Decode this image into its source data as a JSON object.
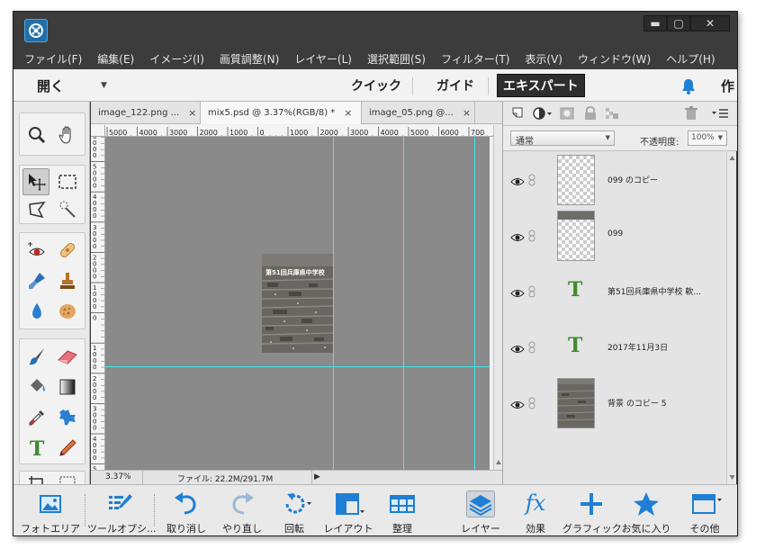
{
  "menubar": {
    "items": [
      "ファイル(F)",
      "編集(E)",
      "イメージ(I)",
      "画質調整(N)",
      "レイヤー(L)",
      "選択範囲(S)",
      "フィルター(T)",
      "表示(V)",
      "ウィンドウ(W)",
      "ヘルプ(H)"
    ]
  },
  "modebar": {
    "open_label": "開く",
    "quick": "クイック",
    "guide": "ガイド",
    "expert": "エキスパート",
    "create": "作"
  },
  "window_buttons": {
    "minimize": "▬",
    "maximize": "▢",
    "close": "✕"
  },
  "tabs": [
    {
      "label": "image_122.png ...",
      "close": "×"
    },
    {
      "label": "mix5.psd @ 3.37%(RGB/8) *",
      "close": "×"
    },
    {
      "label": "image_05.png @...",
      "close": "×"
    }
  ],
  "ruler": {
    "h_ticks": [
      "5000",
      "4000",
      "3000",
      "2000",
      "1000",
      "0",
      "1000",
      "2000",
      "3000",
      "4000",
      "5000",
      "6000",
      "700"
    ],
    "v_ticks": [
      "6\n0\n0\n0",
      "5\n0\n0\n0",
      "4\n0\n0\n0",
      "3\n0\n0\n0",
      "2\n0\n0\n0",
      "1\n0\n0\n0",
      "0",
      "1\n0\n0\n0",
      "2\n0\n0\n0",
      "3\n0\n0\n0",
      "4\n0\n0\n0",
      "5\n0\n0\n0"
    ]
  },
  "canvas": {
    "photo_title": "第51回兵庫県中学校"
  },
  "status": {
    "zoom": "3.37%",
    "file_info": "ファイル: 22.2M/291.7M",
    "arrow": "▶"
  },
  "layers_panel": {
    "blend_mode": "通常",
    "opacity_label": "不透明度:",
    "opacity_value": "100%",
    "layers": [
      {
        "name": "099 のコピー",
        "type": "empty"
      },
      {
        "name": "099",
        "type": "empty-top"
      },
      {
        "name": "第51回兵庫県中学校 軟...",
        "type": "text"
      },
      {
        "name": "2017年11月3日",
        "type": "text"
      },
      {
        "name": "背景 のコピー 5",
        "type": "photo"
      }
    ],
    "text_glyph": "T"
  },
  "bottombar": {
    "photo_bin": "フォトエリア",
    "tool_options": "ツールオプシ...",
    "undo": "取り消し",
    "redo": "やり直し",
    "rotate": "回転",
    "layout": "レイアウト",
    "organize": "整理",
    "layers": "レイヤー",
    "effects": "効果",
    "effects_glyph": "fx",
    "graphics": "グラフィック",
    "favorites": "お気に入り",
    "more": "その他"
  },
  "colors": {
    "accent_blue": "#1f7fd4",
    "guide_cyan": "#3ee8f0",
    "text_layer_green": "#3f8a2e"
  }
}
